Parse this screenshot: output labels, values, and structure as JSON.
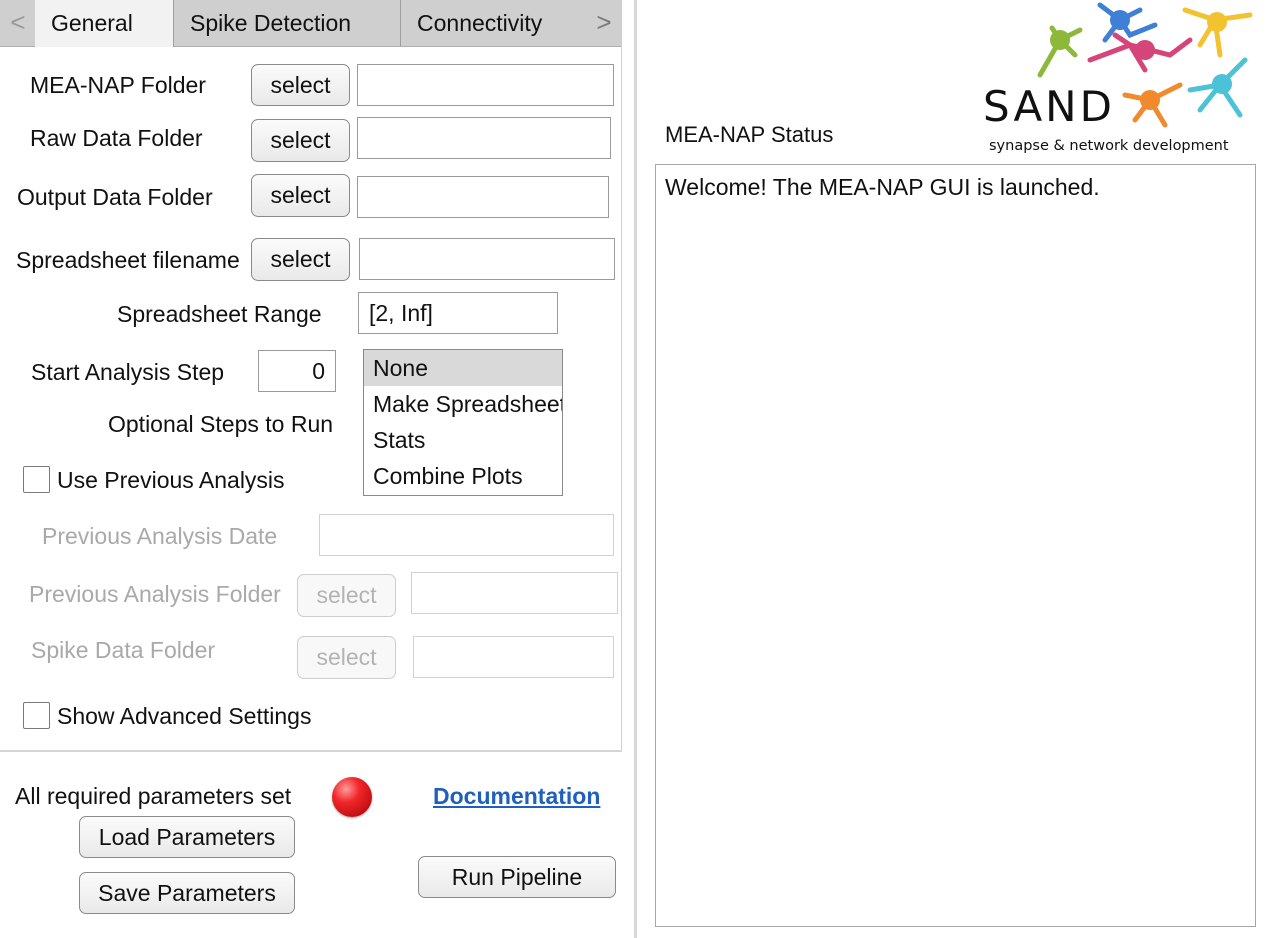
{
  "tabs": {
    "items": [
      "General",
      "Spike Detection",
      "Connectivity"
    ],
    "prev_arrow": "<",
    "next_arrow": ">"
  },
  "general": {
    "mea_nap_folder": {
      "label": "MEA-NAP Folder",
      "button": "select",
      "value": ""
    },
    "raw_data_folder": {
      "label": "Raw Data Folder",
      "button": "select",
      "value": ""
    },
    "output_data_folder": {
      "label": "Output Data Folder",
      "button": "select",
      "value": ""
    },
    "spreadsheet_filename": {
      "label": "Spreadsheet filename",
      "button": "select",
      "value": ""
    },
    "spreadsheet_range": {
      "label": "Spreadsheet Range",
      "value": "[2, Inf]"
    },
    "start_analysis_step": {
      "label": "Start Analysis Step",
      "value": "0"
    },
    "optional_steps": {
      "label": "Optional Steps to Run",
      "options": [
        "None",
        "Make Spreadsheet",
        "Stats",
        "Combine Plots"
      ],
      "selected": "None"
    },
    "use_previous_analysis": {
      "label": "Use Previous Analysis",
      "checked": false
    },
    "previous_analysis_date": {
      "label": "Previous Analysis Date",
      "value": ""
    },
    "previous_analysis_folder": {
      "label": "Previous Analysis Folder",
      "button": "select",
      "value": ""
    },
    "spike_data_folder": {
      "label": "Spike Data Folder",
      "button": "select",
      "value": ""
    },
    "show_advanced_settings": {
      "label": "Show Advanced Settings",
      "checked": false
    }
  },
  "footer": {
    "required_label": "All required parameters set",
    "status_lamp_color": "#e0161a",
    "documentation_link": "Documentation",
    "load_button": "Load Parameters",
    "save_button": "Save Parameters",
    "run_button": "Run Pipeline"
  },
  "status": {
    "title": "MEA-NAP Status",
    "text": "Welcome! The MEA-NAP GUI is launched."
  },
  "logo": {
    "text": "SAND",
    "tagline": "synapse & network development"
  },
  "colors": {
    "link": "#1f5fbf",
    "logo_green": "#8db83a",
    "logo_blue": "#3f7fd6",
    "logo_pink": "#d6457a",
    "logo_yellow": "#f2c230",
    "logo_orange": "#f08a2c",
    "logo_cyan": "#4bc2d6"
  }
}
